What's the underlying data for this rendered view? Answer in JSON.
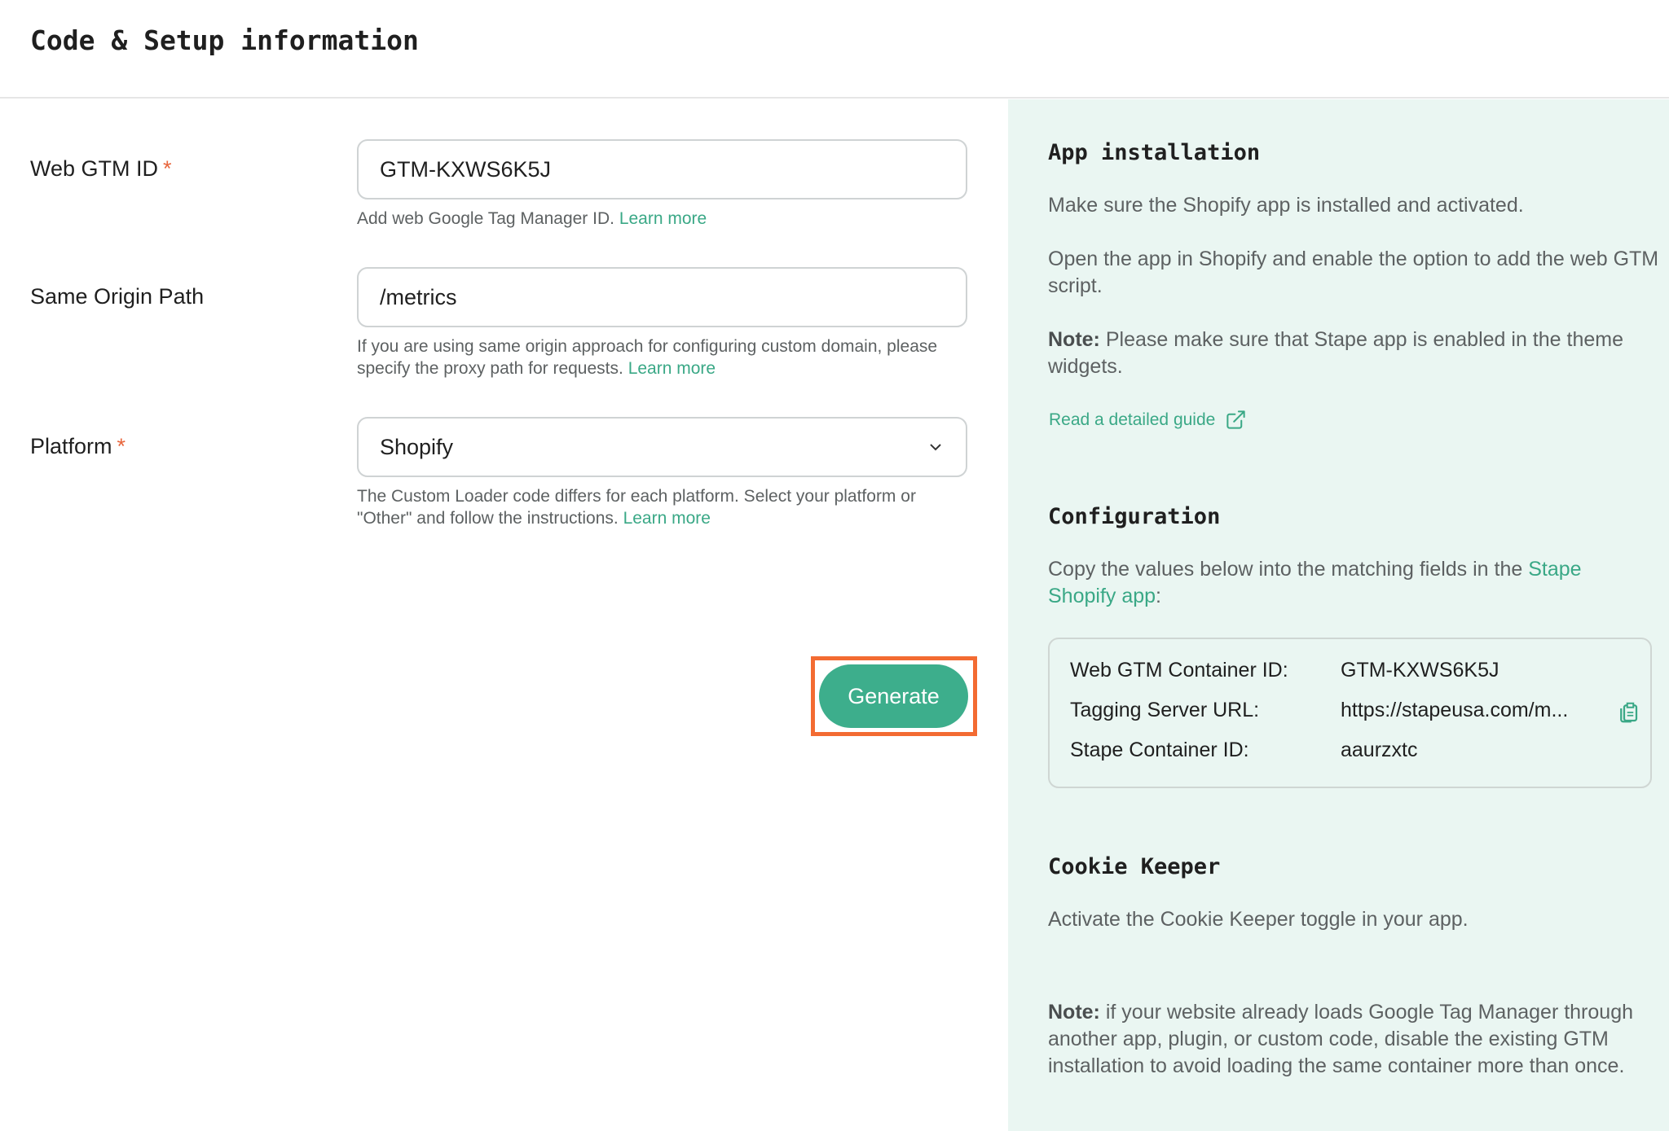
{
  "header": {
    "title": "Code & Setup information"
  },
  "form": {
    "web_gtm_id": {
      "label": "Web GTM ID",
      "required_mark": "*",
      "value": "GTM-KXWS6K5J",
      "help": "Add web Google Tag Manager ID.",
      "help_link": "Learn more"
    },
    "same_origin_path": {
      "label": "Same Origin Path",
      "value": "/metrics",
      "help": "If you are using same origin approach for configuring custom domain, please specify the proxy path for requests.",
      "help_link": "Learn more"
    },
    "platform": {
      "label": "Platform",
      "required_mark": "*",
      "selected": "Shopify",
      "help": "The Custom Loader code differs for each platform. Select your platform or \"Other\" and follow the instructions.",
      "help_link": "Learn more"
    },
    "generate_label": "Generate"
  },
  "app_installation": {
    "title": "App installation",
    "para1": "Make sure the Shopify app is installed and activated.",
    "para2": "Open the app in Shopify and enable the option to add the web GTM script.",
    "note_label": "Note:",
    "note_text": "Please make sure that Stape app is enabled in the theme widgets.",
    "guide_link": "Read a detailed guide"
  },
  "configuration": {
    "title": "Configuration",
    "intro": "Copy the values below into the matching fields in the",
    "intro_link": "Stape Shopify app",
    "intro_end": ":",
    "rows": [
      {
        "key": "Web GTM Container ID:",
        "value": "GTM-KXWS6K5J"
      },
      {
        "key": "Tagging Server URL:",
        "value": "https://stapeusa.com/m..."
      },
      {
        "key": "Stape Container ID:",
        "value": "aaurzxtc"
      }
    ]
  },
  "cookie_keeper": {
    "title": "Cookie Keeper",
    "text": "Activate the Cookie Keeper toggle in your app.",
    "note_label": "Note:",
    "note_text": "if your website already loads Google Tag Manager through another app, plugin, or custom code, disable the existing GTM installation to avoid loading the same container more than once."
  },
  "colors": {
    "accent": "#3dae8c",
    "highlight": "#f36b32",
    "panel_bg": "#eaf6f2",
    "required": "#e8663d"
  },
  "icons": [
    "chevron-down-icon",
    "external-link-icon",
    "copy-icon"
  ]
}
